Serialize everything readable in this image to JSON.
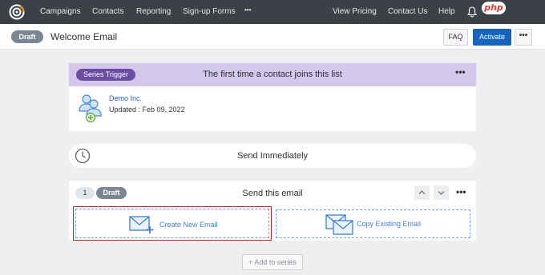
{
  "topnav": {
    "items": [
      {
        "label": "Campaigns"
      },
      {
        "label": "Contacts"
      },
      {
        "label": "Reporting"
      },
      {
        "label": "Sign-up Forms"
      },
      {
        "label": "•••"
      }
    ],
    "right_items": [
      {
        "label": "View Pricing"
      },
      {
        "label": "Contact Us"
      },
      {
        "label": "Help"
      }
    ],
    "icons": {
      "logo": "constant-contact-logo-icon",
      "notifications": "bell-icon"
    },
    "watermark": "php"
  },
  "header": {
    "status": "Draft",
    "title": "Welcome Email",
    "faq_label": "FAQ",
    "activate_label": "Activate",
    "more_label": "•••"
  },
  "trigger": {
    "badge": "Series Trigger",
    "description": "The first time a contact joins this list",
    "more_label": "•••",
    "list_name": "Demo Inc.",
    "updated": "Updated : Feb 09, 2022"
  },
  "timing": {
    "label": "Send Immediately",
    "icon": "clock-icon"
  },
  "step": {
    "number": "1",
    "status": "Draft",
    "title": "Send this email",
    "more_label": "•••",
    "create_label": "Create New Email",
    "copy_label": "Copy Existing Email"
  },
  "footer": {
    "add_label": "+ Add to series"
  },
  "colors": {
    "nav_bg": "#3b4147",
    "accent_blue": "#1565c0",
    "trigger_bg": "#d3c8ea",
    "trigger_badge": "#6a4ca3",
    "draft_badge": "#7a8691",
    "selected_border": "#c1272d"
  }
}
